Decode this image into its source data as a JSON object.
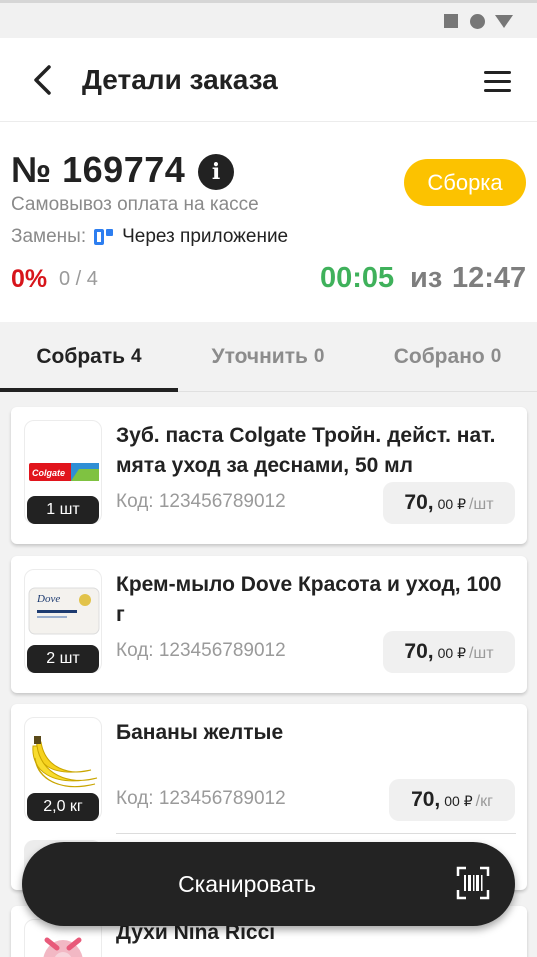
{
  "header": {
    "title": "Детали заказа"
  },
  "order": {
    "number": "№ 169774",
    "status": "Сборка",
    "delivery": "Самовывоз оплата на кассе",
    "replacements_label": "Замены:",
    "replacements_value": "Через приложение",
    "progress_percent": "0%",
    "progress_count": "0 / 4",
    "time_elapsed": "00:05",
    "time_separator": "из",
    "time_total": "12:47"
  },
  "tabs": [
    {
      "label": "Собрать",
      "count": "4",
      "active": true
    },
    {
      "label": "Уточнить",
      "count": "0",
      "active": false
    },
    {
      "label": "Собрано",
      "count": "0",
      "active": false
    }
  ],
  "items": [
    {
      "name": "Зуб. паста Colgate Тройн. дейст. нат. мята уход за деснами, 50 мл",
      "code": "Код: 123456789012",
      "qty": "1 шт",
      "price_main": "70,",
      "price_cents": "00 ₽",
      "price_unit": "/шт",
      "image_text": "Colgate"
    },
    {
      "name": "Крем-мыло Dove Красота и уход, 100 г",
      "code": "Код: 123456789012",
      "qty": "2 шт",
      "price_main": "70,",
      "price_cents": "00 ₽",
      "price_unit": "/шт",
      "image_text": "Dove"
    },
    {
      "name": "Бананы желтые",
      "code": "Код: 123456789012",
      "qty": "2,0 кг",
      "price_main": "70,",
      "price_cents": "00 ₽",
      "price_unit": "/кг"
    },
    {
      "name": "Духи Nina Ricci"
    }
  ],
  "scan_button": {
    "label": "Сканировать"
  },
  "colors": {
    "accent": "#fcc200",
    "danger": "#d7151b",
    "success": "#3fb15b",
    "dark": "#222222",
    "link": "#2d7ef0"
  }
}
